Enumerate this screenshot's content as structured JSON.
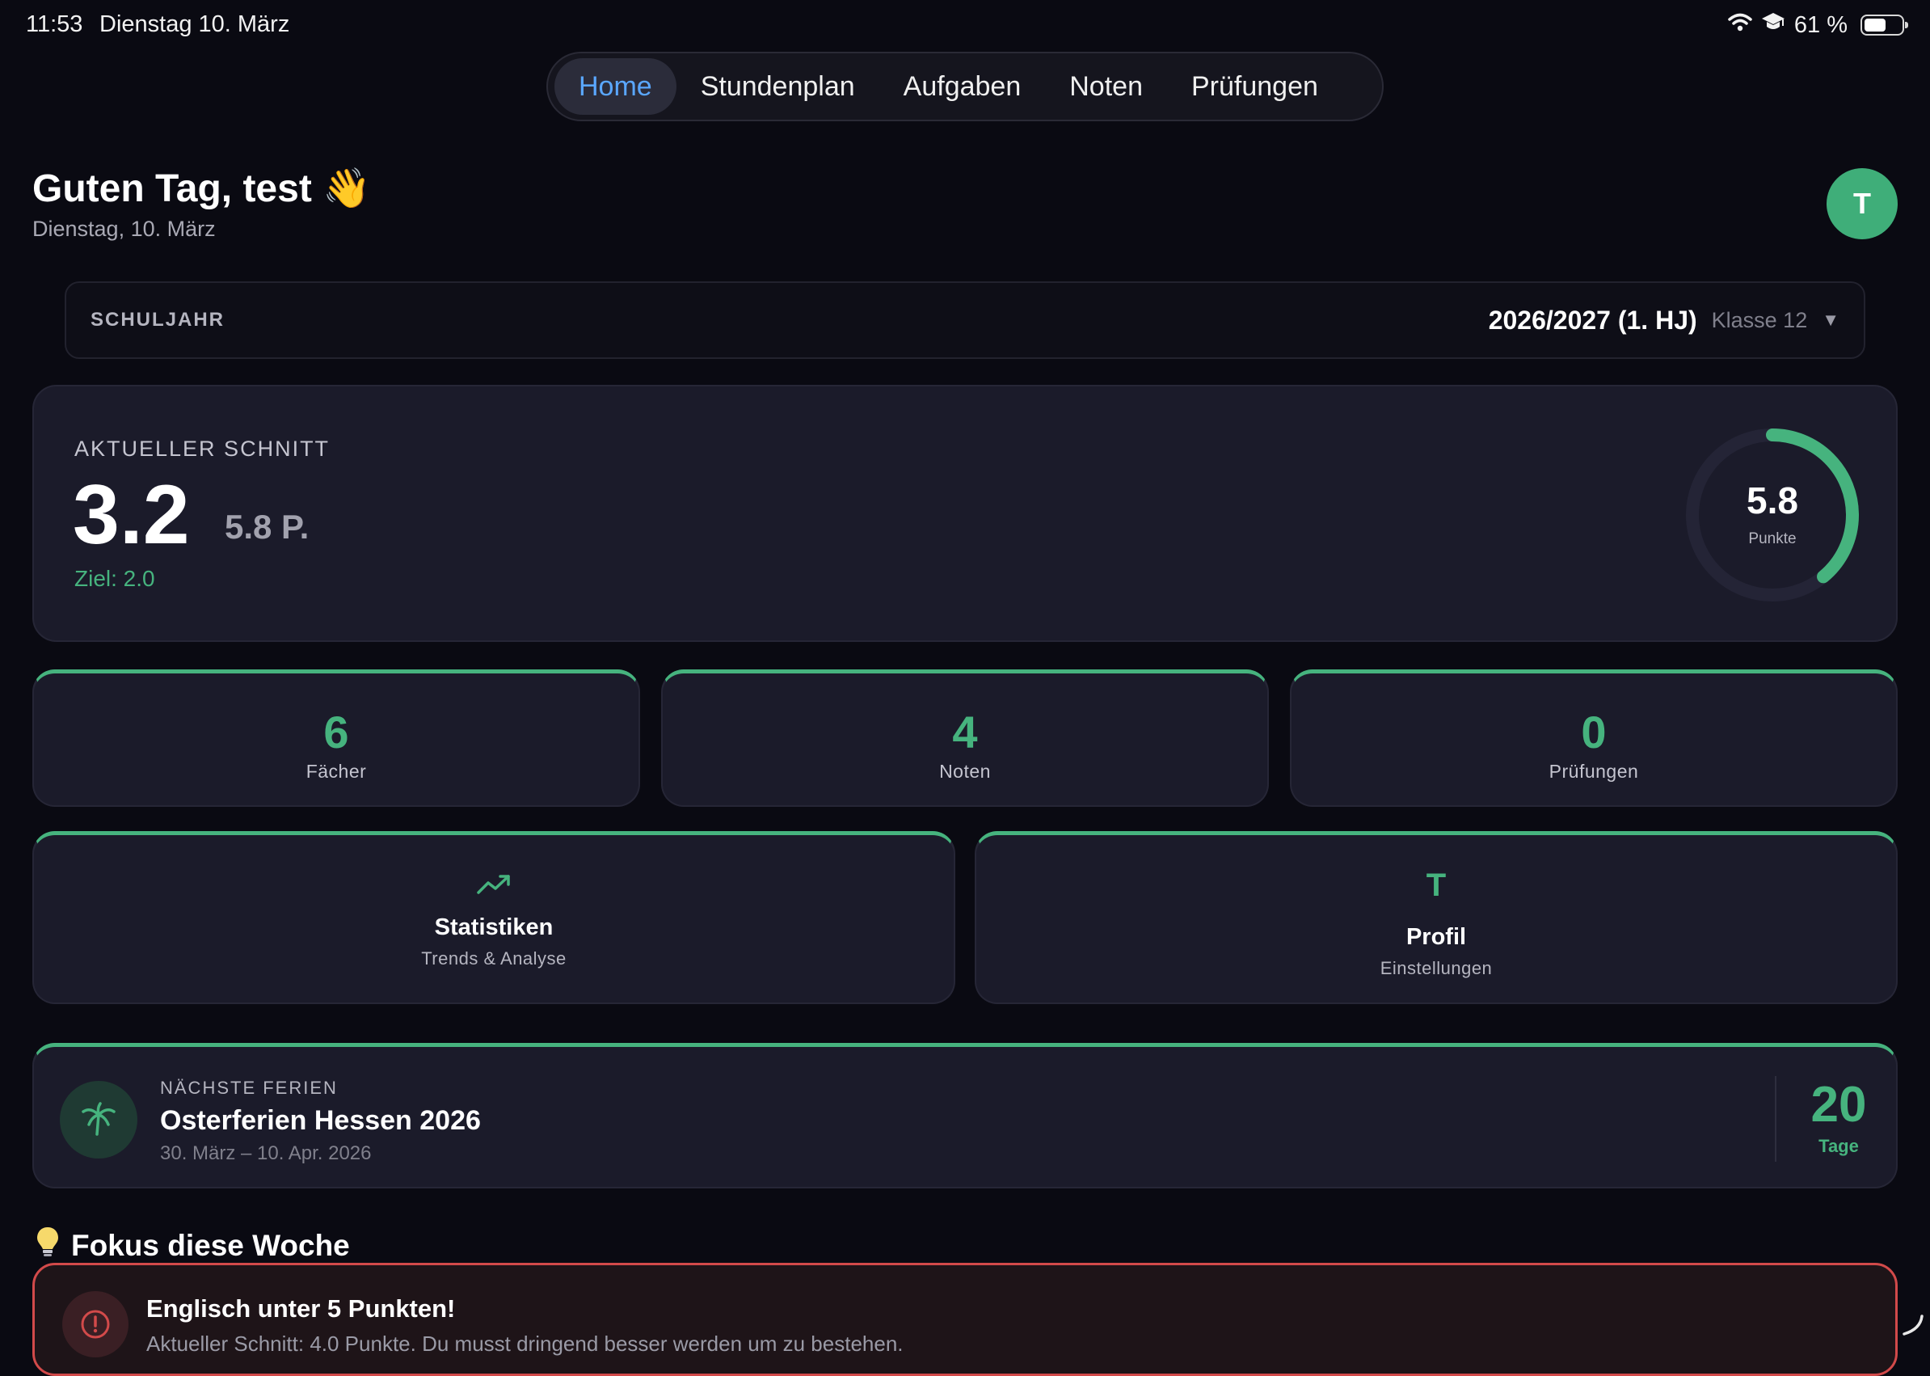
{
  "status_bar": {
    "time": "11:53",
    "date": "Dienstag 10. März",
    "battery": "61 %",
    "battery_level": 0.61,
    "icons": [
      "wifi-icon",
      "graduation-cap-icon",
      "battery-icon"
    ]
  },
  "nav": {
    "tabs": [
      {
        "label": "Home",
        "active": true
      },
      {
        "label": "Stundenplan",
        "active": false
      },
      {
        "label": "Aufgaben",
        "active": false
      },
      {
        "label": "Noten",
        "active": false
      },
      {
        "label": "Prüfungen",
        "active": false
      }
    ]
  },
  "header": {
    "greeting": "Guten Tag, test 👋",
    "date": "Dienstag, 10. März",
    "avatar_initial": "T"
  },
  "school_year": {
    "label": "SCHULJAHR",
    "value": "2026/2027 (1. HJ)",
    "klasse": "Klasse 12",
    "dropdown_icon": "▼"
  },
  "average": {
    "label": "AKTUELLER SCHNITT",
    "grade": "3.2",
    "points": "5.8 P.",
    "goal": "Ziel: 2.0",
    "ring_value": "5.8",
    "ring_label": "Punkte",
    "ring_fraction": 0.39
  },
  "stats": [
    {
      "value": "6",
      "label": "Fächer"
    },
    {
      "value": "4",
      "label": "Noten"
    },
    {
      "value": "0",
      "label": "Prüfungen"
    }
  ],
  "actions": {
    "statistics": {
      "title": "Statistiken",
      "subtitle": "Trends & Analyse",
      "icon": "trending-up-icon"
    },
    "profile": {
      "title": "Profil",
      "subtitle": "Einstellungen",
      "icon_letter": "T"
    }
  },
  "holiday": {
    "label": "NÄCHSTE FERIEN",
    "title": "Osterferien Hessen 2026",
    "dates": "30. März – 10. Apr. 2026",
    "days": "20",
    "days_label": "Tage",
    "icon": "palm-tree-icon"
  },
  "focus": {
    "title": "Fokus diese Woche",
    "icon": "lightbulb-icon",
    "alert": {
      "title": "Englisch unter 5 Punkten!",
      "text": "Aktueller Schnitt: 4.0 Punkte. Du musst dringend besser werden um zu bestehen.",
      "icon": "alert-circle-icon"
    }
  },
  "colors": {
    "background": "#0a0a12",
    "card": "#1b1b2a",
    "accent_green": "#46b37e",
    "accent_blue": "#5aa7ff",
    "alert_red": "#d24a4a"
  }
}
